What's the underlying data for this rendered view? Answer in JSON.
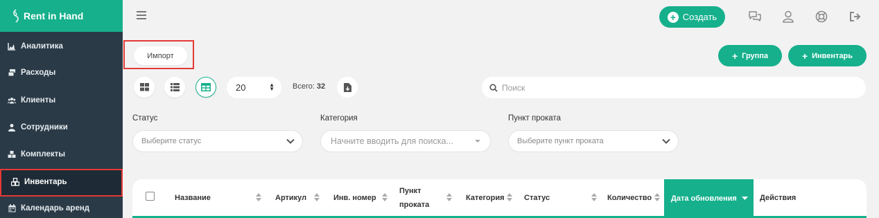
{
  "brand": {
    "name": "Rent in Hand"
  },
  "sidebar": {
    "items": [
      {
        "label": "Аналитика",
        "icon": "chart-area-icon"
      },
      {
        "label": "Расходы",
        "icon": "money-icon"
      },
      {
        "label": "Клиенты",
        "icon": "users-icon"
      },
      {
        "label": "Сотрудники",
        "icon": "user-tie-icon"
      },
      {
        "label": "Комплекты",
        "icon": "boxes-icon"
      },
      {
        "label": "Инвентарь",
        "icon": "cubes-icon",
        "active": true
      },
      {
        "label": "Календарь аренд",
        "icon": "calendar-icon"
      }
    ]
  },
  "topbar": {
    "create_label": "Создать"
  },
  "toolbar": {
    "import_label": "Импорт",
    "group_label": "Группа",
    "inventory_label": "Инвентарь",
    "per_page": "20",
    "total_label": "Всего:",
    "total_value": "32",
    "search_placeholder": "Поиск"
  },
  "filters": {
    "status": {
      "label": "Статус",
      "placeholder": "Выберите статус"
    },
    "category": {
      "label": "Категория",
      "placeholder": "Начните вводить для поиска..."
    },
    "rental_point": {
      "label": "Пункт проката",
      "placeholder": "Выберите пункт проката"
    }
  },
  "table": {
    "columns": {
      "name": "Название",
      "article": "Артикул",
      "inv_number": "Инв. номер",
      "rental_point_1": "Пункт",
      "rental_point_2": "проката",
      "category": "Категория",
      "status": "Статус",
      "quantity": "Количество",
      "updated": "Дата обновления",
      "actions": "Действия"
    }
  },
  "colors": {
    "accent": "#16b08c",
    "sidebar": "#2b3a47",
    "highlight": "#e53935"
  }
}
